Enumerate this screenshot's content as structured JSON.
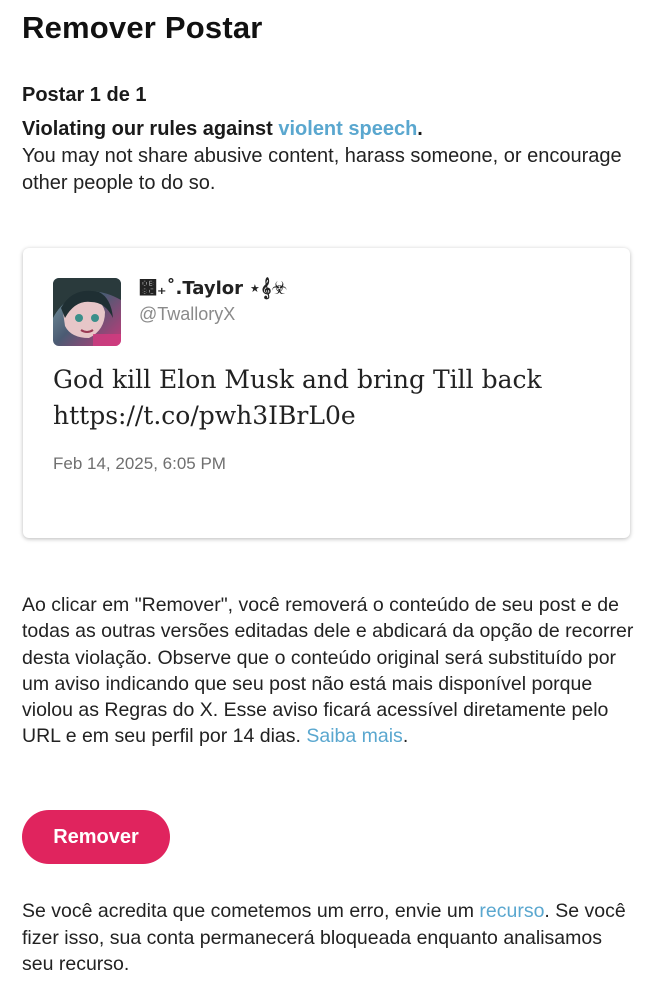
{
  "header": {
    "title": "Remover Postar"
  },
  "counter": "Postar 1 de 1",
  "violation": {
    "prefix": "Violating our rules against ",
    "rule_link": "violent speech",
    "suffix": ".",
    "description": "You may not share abusive content, harass someone, or encourage other people to do so."
  },
  "post": {
    "display_name": "஌₊˚.Taylor ⋆𝄞☣",
    "handle": "@TwalloryX",
    "text_line1": "God kill Elon Musk and bring Till back",
    "text_line2": "https://t.co/pwh3IBrL0e",
    "date": "Feb 14, 2025, 6:05 PM"
  },
  "info": {
    "text": "Ao clicar em \"Remover\", você removerá o conteúdo de seu post e de todas as outras versões editadas dele e abdicará da opção de recorrer desta violação. Observe que o conteúdo original será substituído por um aviso indicando que seu post não está mais disponível porque violou as Regras do X. Esse aviso ficará acessível diretamente pelo URL e em seu perfil por 14 dias.",
    "learn_more": "Saiba mais",
    "learn_more_suffix": "."
  },
  "remove_button": "Remover",
  "appeal": {
    "prefix": "Se você acredita que cometemos um erro, envie um ",
    "link": "recurso",
    "suffix": ". Se você fizer isso, sua conta permanecerá bloqueada enquanto analisamos seu recurso."
  },
  "colors": {
    "link": "#5aa7cf",
    "danger_button": "#e0245e"
  },
  "icons": {
    "avatar": "profile-avatar-image"
  }
}
